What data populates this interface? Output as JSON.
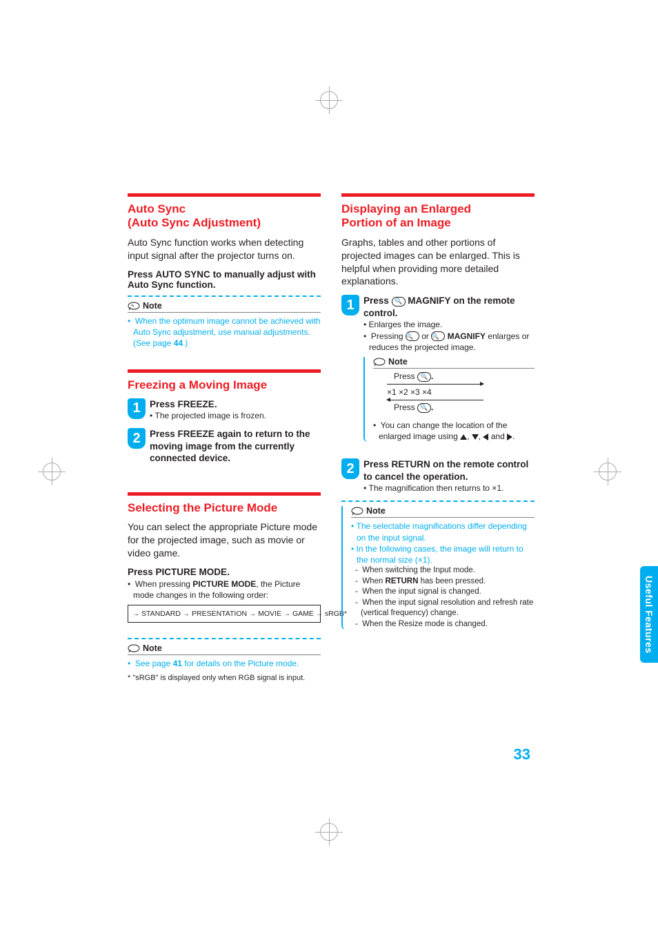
{
  "page_number": "33",
  "side_tab": "Useful Features",
  "left": {
    "auto_sync": {
      "title_l1": "Auto Sync",
      "title_l2": "(Auto Sync Adjustment)",
      "body": "Auto Sync function works when detecting input signal after the projector turns on.",
      "instr_pre": "Press ",
      "instr_bold": "AUTO SYNC",
      "instr_post": " to manually adjust with Auto Sync function.",
      "note_label": "Note",
      "note_text_pre": "When the optimum image cannot be achieved with Auto Sync adjustment, use manual adjustments. (See page ",
      "note_link": "44",
      "note_text_post": ".)"
    },
    "freeze": {
      "title": "Freezing a Moving Image",
      "step1_num": "1",
      "step1_pre": "Press ",
      "step1_bold": "FREEZE",
      "step1_post": ".",
      "step1_sub": "The projected image is frozen.",
      "step2_num": "2",
      "step2_pre": "Press ",
      "step2_bold": "FREEZE",
      "step2_post": " again to return to the moving image from the currently connected device."
    },
    "picture": {
      "title": "Selecting the Picture Mode",
      "body": "You can select the appropriate Picture mode for the projected image, such as movie or video game.",
      "instr_pre": "Press ",
      "instr_bold": "PICTURE MODE",
      "instr_post": ".",
      "sub_pre": "When pressing ",
      "sub_bold": "PICTURE MODE",
      "sub_post": ", the Picture mode changes in the following order:",
      "flow": [
        "STANDARD",
        "PRESENTATION",
        "MOVIE",
        "GAME",
        "sRGB*"
      ],
      "note_label": "Note",
      "note_text_pre": "See page ",
      "note_link": "41",
      "note_text_post": " for details on the Picture mode.",
      "star": "*   \"sRGB\" is displayed only when RGB signal is input."
    }
  },
  "right": {
    "magnify": {
      "title_l1": "Displaying an Enlarged",
      "title_l2": "Portion of an Image",
      "body": "Graphs, tables and other portions of projected images can be enlarged. This is helpful when providing more detailed explanations.",
      "step1_num": "1",
      "step1_pre": "Press ",
      "step1_icon": "⊕",
      "step1_bold": " MAGNIFY",
      "step1_post": " on the remote control.",
      "step1_sub1": "Enlarges the image.",
      "step1_sub2_pre": "Pressing ",
      "step1_sub2_bold": "MAGNIFY",
      "step1_sub2_post": " enlarges or reduces the projected image.",
      "note_label": "Note",
      "press_plus": "Press ",
      "levels": "×1   ×2   ×3   ×4",
      "press_minus": "Press ",
      "loc_pre": "You can change the location of the enlarged image using ",
      "loc_post": ".",
      "step2_num": "2",
      "step2_pre": "Press ",
      "step2_bold": "RETURN",
      "step2_post": " on the remote control to cancel the operation.",
      "step2_sub": "The magnification then returns to ×1.",
      "note2_label": "Note",
      "n2_b1": "The selectable magnifications differ depending on the input signal.",
      "n2_b2": "In the following cases, the image will return to the normal size (×1).",
      "n2_d1": "When switching the Input mode.",
      "n2_d2_pre": "When ",
      "n2_d2_bold": "RETURN",
      "n2_d2_post": " has been pressed.",
      "n2_d3": "When the input signal is changed.",
      "n2_d4": "When the input signal resolution and refresh rate (vertical frequency) change.",
      "n2_d5": "When the Resize mode is changed."
    }
  }
}
